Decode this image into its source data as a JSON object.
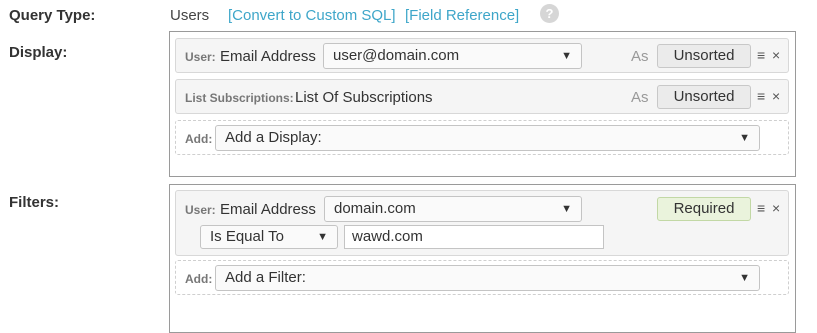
{
  "query_type": {
    "label": "Query Type:",
    "value": "Users",
    "convert_link": "[Convert to Custom SQL]",
    "reference_link": "[Field Reference]",
    "help_icon": "?"
  },
  "display": {
    "label": "Display:",
    "rows": [
      {
        "prefix": "User:",
        "field": "Email Address",
        "select_value": "user@domain.com",
        "as_label": "As",
        "sort_button": "Unsorted",
        "drag_icon": "≡",
        "remove_icon": "×"
      },
      {
        "prefix": "List Subscriptions:",
        "field": "List Of Subscriptions",
        "as_label": "As",
        "sort_button": "Unsorted",
        "drag_icon": "≡",
        "remove_icon": "×"
      }
    ],
    "add": {
      "prefix": "Add:",
      "select_value": "Add a Display:"
    }
  },
  "filters": {
    "label": "Filters:",
    "rows": [
      {
        "prefix": "User:",
        "field": "Email Address",
        "select_value": "domain.com",
        "required_button": "Required",
        "drag_icon": "≡",
        "remove_icon": "×",
        "operator": "Is Equal To",
        "input_value": "wawd.com"
      }
    ],
    "add": {
      "prefix": "Add:",
      "select_value": "Add a Filter:"
    }
  },
  "caret_icon": "▼"
}
